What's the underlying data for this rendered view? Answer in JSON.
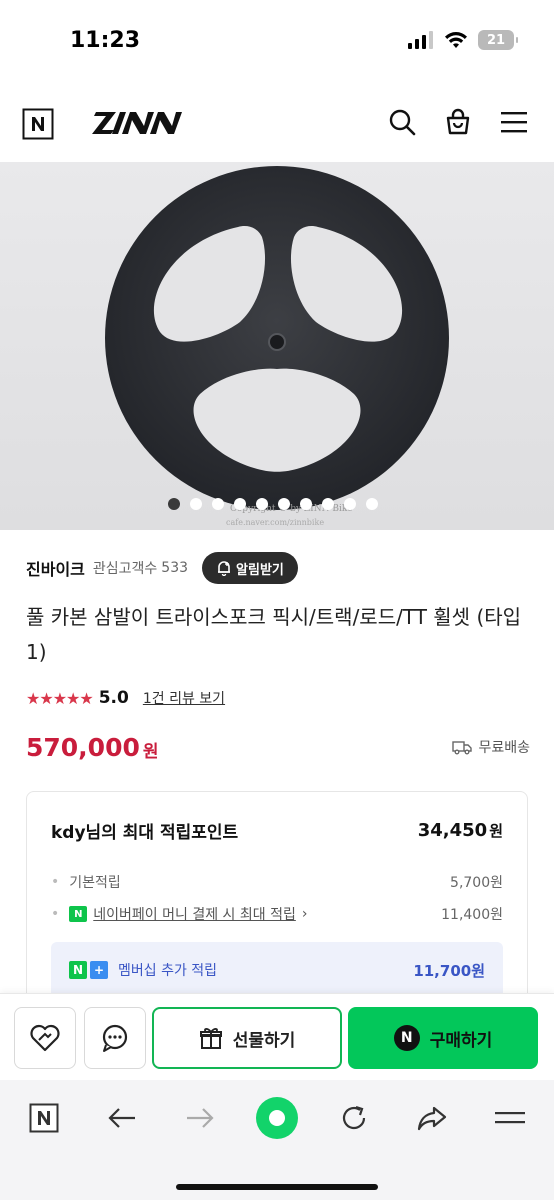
{
  "status_bar": {
    "time": "11:23",
    "battery": "21"
  },
  "header": {
    "logo": "N",
    "brand": "ZINN",
    "icons": [
      "search-icon",
      "cart-icon",
      "menu-icon"
    ]
  },
  "hero": {
    "watermark": "Copyright © by ZINN Bike",
    "watermark2": "cafe.naver.com/zinnbike",
    "slides_total": 10,
    "slide_current": 1
  },
  "seller": {
    "name": "진바이크",
    "followers_label": "관심고객수",
    "followers": "533",
    "notify_label": "알림받기"
  },
  "product": {
    "title": "풀 카본 삼발이 트라이스포크 픽시/트랙/로드/TT 휠셋 (타입 1)",
    "stars": "★★★★★",
    "rating": "5.0",
    "review_link": "1건 리뷰 보기",
    "price": "570,000",
    "price_unit": "원",
    "shipping": "무료배송"
  },
  "points": {
    "title": "kdy님의 최대 적립포인트",
    "total": "34,450",
    "unit": "원",
    "basic_label": "기본적립",
    "basic_value": "5,700원",
    "npay_label": "네이버페이 머니 결제 시 최대 적립",
    "npay_value": "11,400원",
    "member_label": "멤버십 추가 적립",
    "member_value": "11,700원"
  },
  "actions": {
    "gift_label": "선물하기",
    "buy_label": "구매하기",
    "buy_badge": "N"
  },
  "colors": {
    "accent_green": "#03c75a",
    "price_red": "#c91d3c",
    "member_blue": "#3a56c5"
  }
}
